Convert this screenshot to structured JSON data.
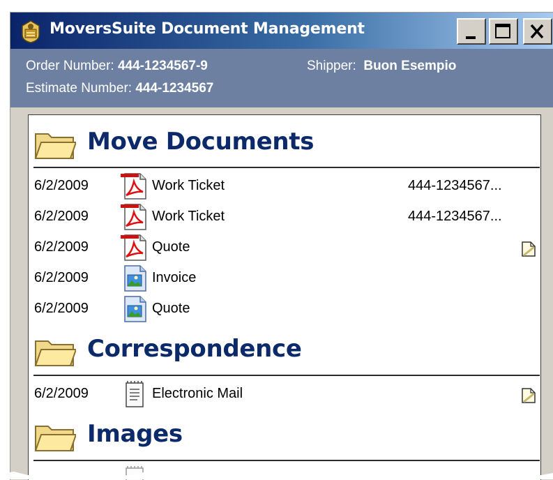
{
  "window": {
    "title": "MoversSuite Document Management",
    "controls": [
      "minimize-icon",
      "maximize-icon",
      "close-icon"
    ]
  },
  "order_info": {
    "order_label": "Order Number:",
    "order_value": "444-1234567-9",
    "estimate_label": "Estimate Number:",
    "estimate_value": "444-1234567",
    "shipper_label": "Shipper:",
    "shipper_value": "Buon Esempio"
  },
  "sections": [
    {
      "title": "Move Documents",
      "rows": [
        {
          "date": "6/2/2009",
          "icon": "pdf-icon",
          "name": "Work Ticket",
          "ref": "444-1234567...",
          "note": false
        },
        {
          "date": "6/2/2009",
          "icon": "pdf-icon",
          "name": "Work Ticket",
          "ref": "444-1234567...",
          "note": false
        },
        {
          "date": "6/2/2009",
          "icon": "pdf-icon",
          "name": "Quote",
          "ref": "",
          "note": true
        },
        {
          "date": "6/2/2009",
          "icon": "image-icon",
          "name": "Invoice",
          "ref": "",
          "note": false
        },
        {
          "date": "6/2/2009",
          "icon": "image-icon",
          "name": "Quote",
          "ref": "",
          "note": false
        }
      ]
    },
    {
      "title": "Correspondence",
      "rows": [
        {
          "date": "6/2/2009",
          "icon": "text-document-icon",
          "name": "Electronic Mail",
          "ref": "",
          "note": true
        }
      ]
    },
    {
      "title": "Images",
      "rows": []
    }
  ],
  "colors": {
    "title_gradient_start": "#0a246a",
    "title_gradient_end": "#a6caf0",
    "info_bar": "#6d80a1",
    "section_title": "#0c2a6a",
    "window_face": "#d4d0c8"
  }
}
